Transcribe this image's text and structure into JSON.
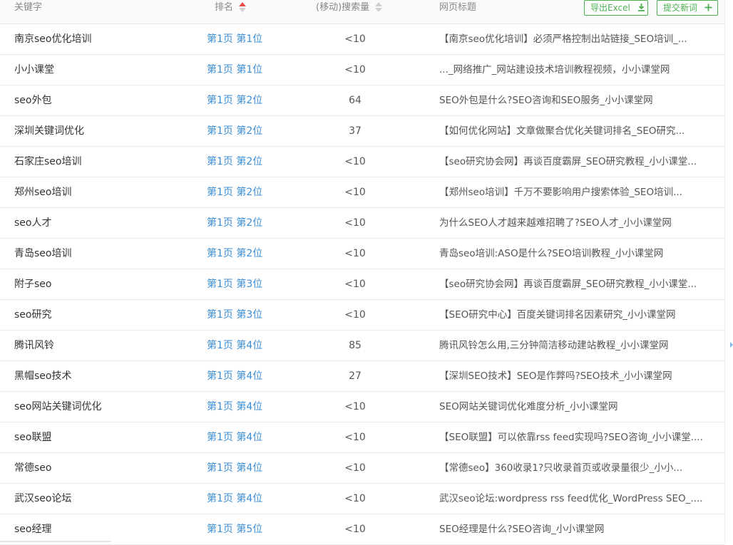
{
  "header": {
    "keyword": "关键字",
    "rank": "排名",
    "volume": "(移动)搜索量",
    "title": "网页标题",
    "export_label": "导出Excel",
    "submit_label": "提交新词",
    "export_icon": "download-icon",
    "submit_icon": "plus-icon",
    "accent_color": "#4caf50",
    "sort_active_color": "#e84a4a"
  },
  "rows": [
    {
      "keyword": "南京seo优化培训",
      "rank": "第1页 第1位",
      "volume": "<10",
      "title": "【南京seo优化培训】必须严格控制出站链接_SEO培训_..."
    },
    {
      "keyword": "小小课堂",
      "rank": "第1页 第1位",
      "volume": "<10",
      "title": "..._网络推广_网站建设技术培训教程视频，小小课堂网"
    },
    {
      "keyword": "seo外包",
      "rank": "第1页 第2位",
      "volume": "64",
      "title": "SEO外包是什么?SEO咨询和SEO服务_小小课堂网"
    },
    {
      "keyword": "深圳关键词优化",
      "rank": "第1页 第2位",
      "volume": "37",
      "title": "【如何优化网站】文章做聚合优化关键词排名_SEO研究..."
    },
    {
      "keyword": "石家庄seo培训",
      "rank": "第1页 第2位",
      "volume": "<10",
      "title": "【seo研究协会网】再谈百度霸屏_SEO研究教程_小小课堂..."
    },
    {
      "keyword": "郑州seo培训",
      "rank": "第1页 第2位",
      "volume": "<10",
      "title": "【郑州seo培训】千万不要影响用户搜索体验_SEO培训..."
    },
    {
      "keyword": "seo人才",
      "rank": "第1页 第2位",
      "volume": "<10",
      "title": "为什么SEO人才越来越难招聘了?SEO人才_小小课堂网"
    },
    {
      "keyword": "青岛seo培训",
      "rank": "第1页 第2位",
      "volume": "<10",
      "title": "青岛seo培训:ASO是什么?SEO培训教程_小小课堂网"
    },
    {
      "keyword": "附子seo",
      "rank": "第1页 第3位",
      "volume": "<10",
      "title": "【seo研究协会网】再谈百度霸屏_SEO研究教程_小小课堂..."
    },
    {
      "keyword": "seo研究",
      "rank": "第1页 第3位",
      "volume": "<10",
      "title": "【SEO研究中心】百度关键词排名因素研究_小小课堂网"
    },
    {
      "keyword": "腾讯风铃",
      "rank": "第1页 第4位",
      "volume": "85",
      "title": "腾讯风铃怎么用,三分钟简洁移动建站教程_小小课堂网"
    },
    {
      "keyword": "黑帽seo技术",
      "rank": "第1页 第4位",
      "volume": "27",
      "title": "【深圳SEO技术】SEO是作弊吗?SEO技术_小小课堂网"
    },
    {
      "keyword": "seo网站关键词优化",
      "rank": "第1页 第4位",
      "volume": "<10",
      "title": "SEO网站关键词优化难度分析_小小课堂网"
    },
    {
      "keyword": "seo联盟",
      "rank": "第1页 第4位",
      "volume": "<10",
      "title": "【SEO联盟】可以依靠rss feed实现吗?SEO咨询_小小课堂...."
    },
    {
      "keyword": "常德seo",
      "rank": "第1页 第4位",
      "volume": "<10",
      "title": "【常德seo】360收录1?只收录首页或收录量很少_小小..."
    },
    {
      "keyword": "武汉seo论坛",
      "rank": "第1页 第4位",
      "volume": "<10",
      "title": "武汉seo论坛:wordpress rss feed优化_WordPress SEO_...."
    },
    {
      "keyword": "seo经理",
      "rank": "第1页 第5位",
      "volume": "<10",
      "title": "SEO经理是什么?SEO咨询_小小课堂网"
    }
  ]
}
